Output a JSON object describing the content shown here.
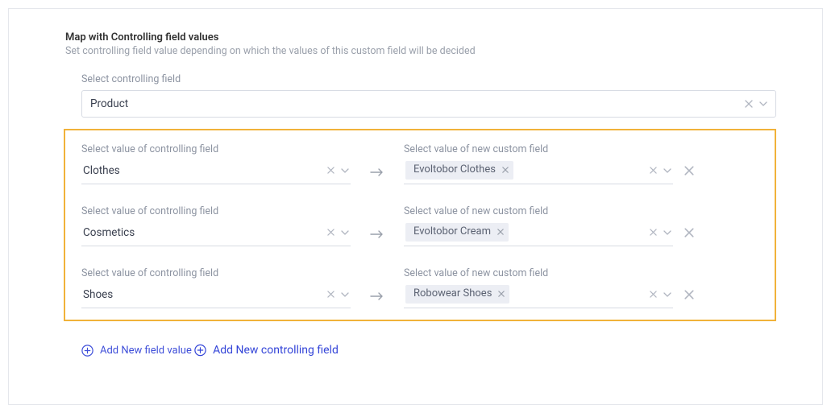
{
  "header": {
    "title": "Map with Controlling field values",
    "subtitle": "Set controlling field value depending on which the values of this custom field will be decided"
  },
  "controlling_field": {
    "label": "Select controlling field",
    "value": "Product"
  },
  "row_labels": {
    "left": "Select value of controlling field",
    "right": "Select value of new custom field"
  },
  "rows": [
    {
      "controlling_value": "Clothes",
      "custom_values": [
        "Evoltobor Clothes"
      ]
    },
    {
      "controlling_value": "Cosmetics",
      "custom_values": [
        "Evoltobor Cream"
      ]
    },
    {
      "controlling_value": "Shoes",
      "custom_values": [
        "Robowear Shoes"
      ]
    }
  ],
  "actions": {
    "add_field_value": "Add New field value",
    "add_controlling_field": "Add New controlling field"
  }
}
